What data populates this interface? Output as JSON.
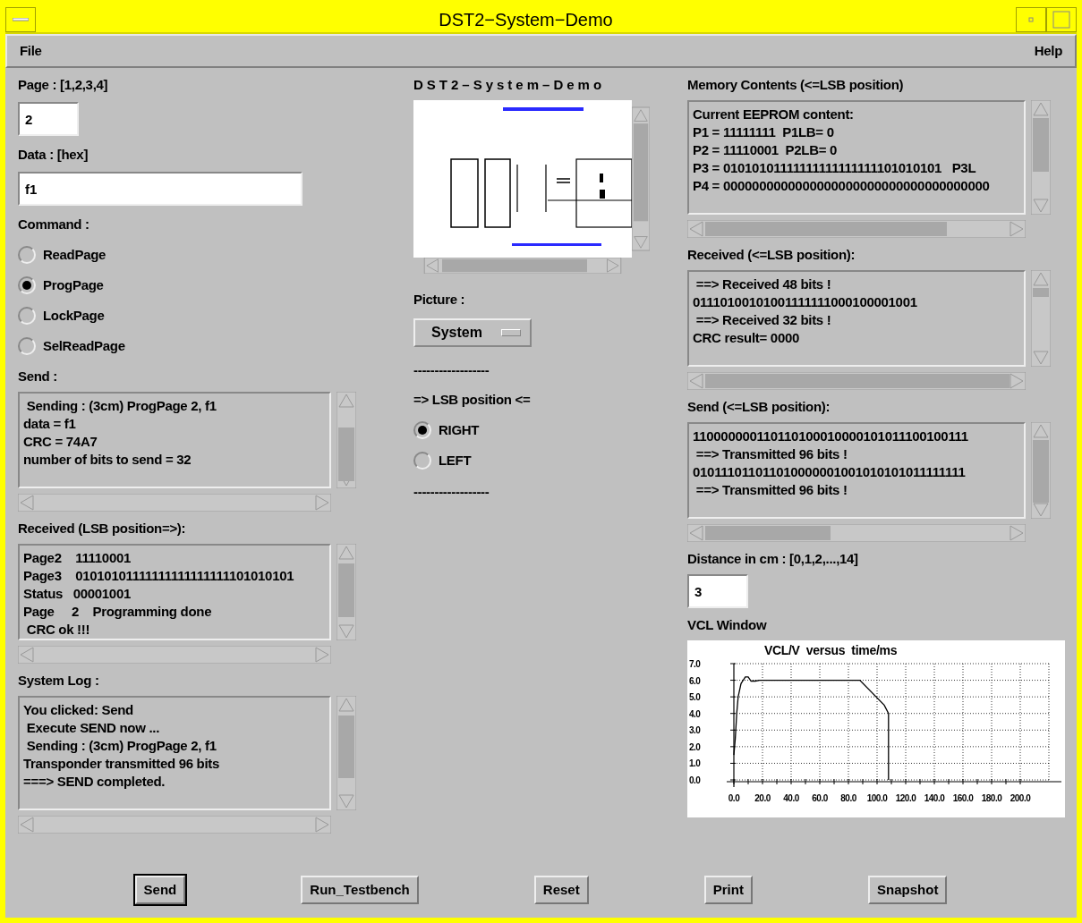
{
  "window": {
    "title": "DST2−System−Demo"
  },
  "menu": [
    {
      "label": "File"
    },
    {
      "label": "Help"
    }
  ],
  "left": {
    "page_label": "Page : [1,2,3,4]",
    "page_value": "2",
    "data_label": "Data : [hex]",
    "data_value": "f1",
    "command_label": "Command :",
    "commands": [
      {
        "label": "ReadPage",
        "selected": false
      },
      {
        "label": "ProgPage",
        "selected": true
      },
      {
        "label": "LockPage",
        "selected": false
      },
      {
        "label": "SelReadPage",
        "selected": false
      }
    ],
    "send_label": "Send :",
    "send_lines": [
      " Sending : (3cm) ProgPage 2, f1",
      "data = f1",
      "CRC = 74A7",
      "number of bits to send = 32"
    ],
    "received_label": "Received (LSB position=>):",
    "received_lines": [
      "Page2    11110001",
      "Page3    01010101111111111111111101010101",
      "Status   00001001",
      "Page     2    Programming done",
      " CRC ok !!!"
    ],
    "log_label": "System Log :",
    "log_lines": [
      "You clicked: Send",
      " Execute SEND now ...",
      " Sending : (3cm) ProgPage 2, f1",
      "Transponder transmitted 96 bits",
      "===> SEND completed."
    ]
  },
  "middle": {
    "title": "DST2–System–Demo",
    "picture_label": "Picture :",
    "picture_choice": "System",
    "separator_1": "------------------",
    "lsb_label": "=> LSB position <=",
    "lsb_options": [
      {
        "label": "RIGHT",
        "selected": true
      },
      {
        "label": "LEFT",
        "selected": false
      }
    ],
    "separator_2": "------------------"
  },
  "right": {
    "memory_label": "Memory Contents (<=LSB position)",
    "memory_lines": [
      "Current EEPROM content:",
      "P1 = 11111111  P1LB= 0",
      "P2 = 11110001  P2LB= 0",
      "P3 = 01010101111111111111111101010101   P3L",
      "P4 = 0000000000000000000000000000000000000"
    ],
    "received_label": "Received (<=LSB position):",
    "received_lines": [
      " ==> Received 48 bits !",
      "01110100101001111111000100001001",
      " ==> Received 32 bits !",
      "CRC result= 0000"
    ],
    "send_label": "Send (<=LSB position):",
    "send_lines": [
      "110000000110110100010000101011100100111",
      " ==> Transmitted 96 bits !",
      "010111011011010000001001010101011111111",
      " ==> Transmitted 96 bits !"
    ],
    "distance_label": "Distance in cm : [0,1,2,...,14]",
    "distance_value": "3",
    "vcl_label": "VCL Window",
    "chart_data": {
      "type": "line",
      "title": "VCL/V  versus  time/ms",
      "x": [
        0,
        1,
        2,
        3,
        5,
        8,
        10,
        12,
        15,
        18,
        50,
        85,
        88,
        105,
        108,
        108
      ],
      "grid": true,
      "series": [
        {
          "color": "#000000",
          "values": [
            1.5,
            2.5,
            4,
            5,
            5.8,
            6.2,
            6.2,
            5.95,
            5.95,
            6,
            6,
            6,
            6,
            4.5,
            4,
            0
          ]
        }
      ],
      "xlim": [
        0,
        220
      ],
      "ylim": [
        0,
        7
      ],
      "xticks": [
        {
          "value": 0,
          "label": "0.0"
        },
        {
          "value": 20,
          "label": "20.0"
        },
        {
          "value": 40,
          "label": "40.0"
        },
        {
          "value": 60,
          "label": "60.0"
        },
        {
          "value": 80,
          "label": "80.0"
        },
        {
          "value": 100,
          "label": "100.0"
        },
        {
          "value": 120,
          "label": "120.0"
        },
        {
          "value": 140,
          "label": "140.0"
        },
        {
          "value": 160,
          "label": "160.0"
        },
        {
          "value": 180,
          "label": "180.0"
        },
        {
          "value": 200,
          "label": "200.0"
        }
      ],
      "yticks": [
        {
          "value": 0,
          "label": "0.0"
        },
        {
          "value": 1,
          "label": "1.0"
        },
        {
          "value": 2,
          "label": "2.0"
        },
        {
          "value": 3,
          "label": "3.0"
        },
        {
          "value": 4,
          "label": "4.0"
        },
        {
          "value": 5,
          "label": "5.0"
        },
        {
          "value": 6,
          "label": "6.0"
        },
        {
          "value": 7,
          "label": "7.0"
        }
      ]
    }
  },
  "buttons": [
    {
      "label": "Send",
      "default": true
    },
    {
      "label": "Run_Testbench",
      "default": false
    },
    {
      "label": "Reset",
      "default": false
    },
    {
      "label": "Print",
      "default": false
    },
    {
      "label": "Snapshot",
      "default": false
    }
  ]
}
